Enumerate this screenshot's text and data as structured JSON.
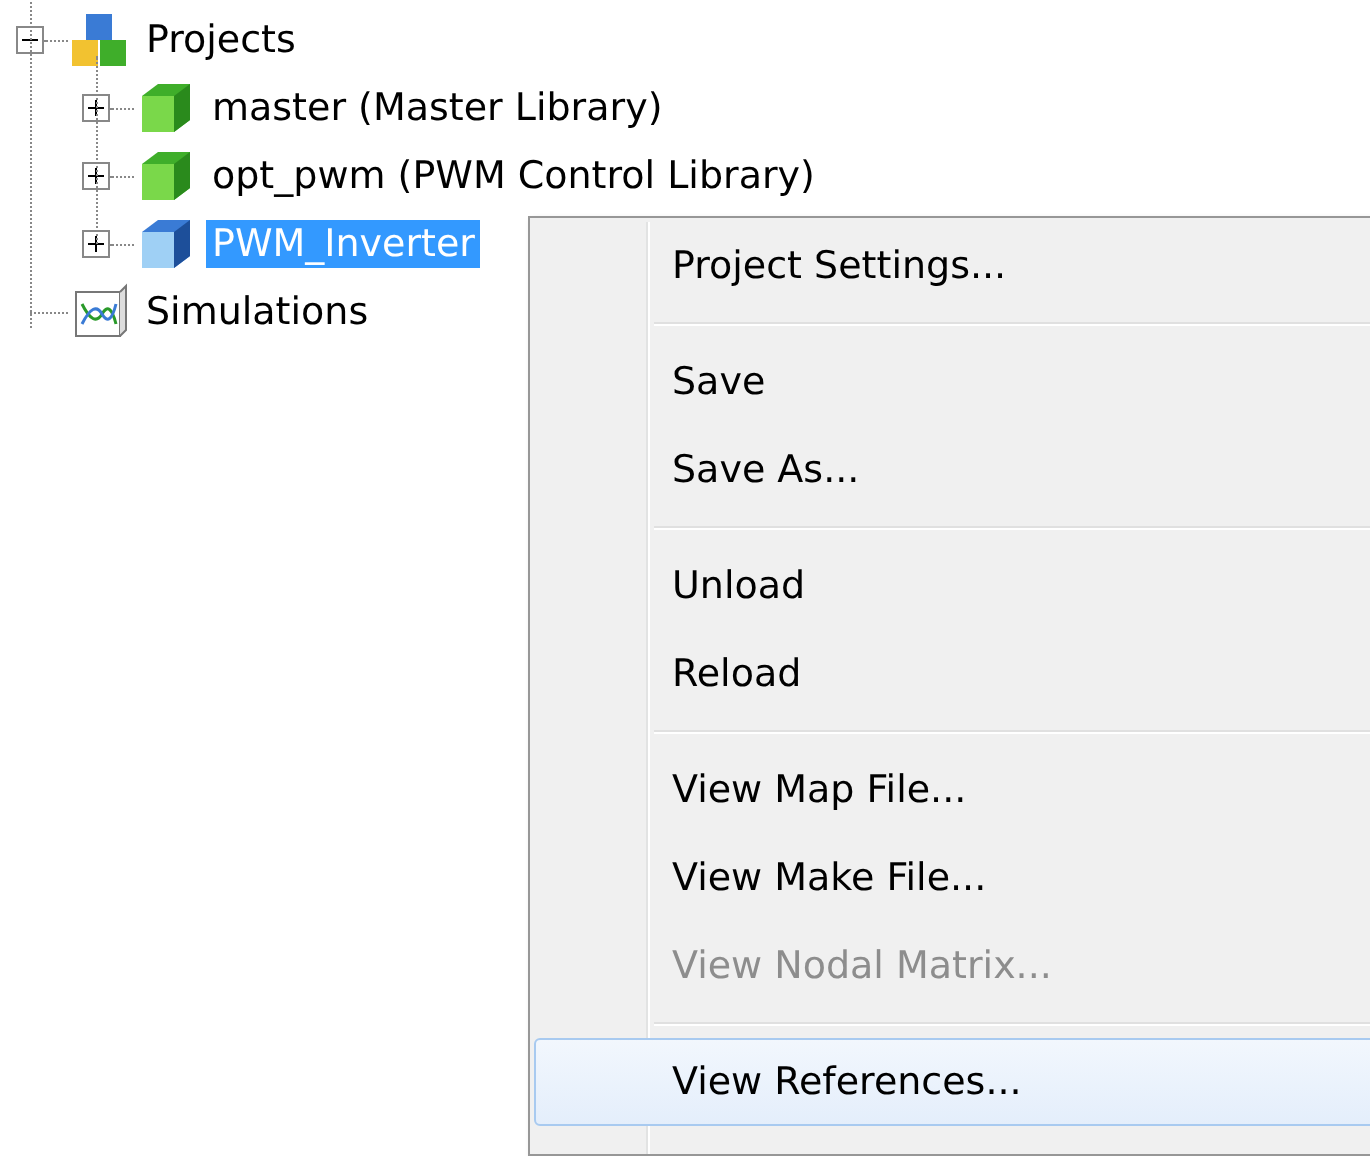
{
  "tree": {
    "label": "Projects",
    "kind": "projects",
    "expanded": true,
    "selected": false,
    "children": [
      {
        "label": "master (Master Library)",
        "kind": "library",
        "expanded": false,
        "selected": false
      },
      {
        "label": "opt_pwm (PWM Control Library)",
        "kind": "library",
        "expanded": false,
        "selected": false
      },
      {
        "label": "PWM_Inverter",
        "kind": "project",
        "expanded": false,
        "selected": true
      }
    ]
  },
  "tree_extra": {
    "label": "Simulations",
    "kind": "simulations"
  },
  "context_menu": {
    "groups": [
      [
        {
          "label": "Project Settings...",
          "disabled": false,
          "selected": false
        }
      ],
      [
        {
          "label": "Save",
          "disabled": false,
          "selected": false
        },
        {
          "label": "Save As...",
          "disabled": false,
          "selected": false
        }
      ],
      [
        {
          "label": "Unload",
          "disabled": false,
          "selected": false
        },
        {
          "label": "Reload",
          "disabled": false,
          "selected": false
        }
      ],
      [
        {
          "label": "View Map File...",
          "disabled": false,
          "selected": false
        },
        {
          "label": "View Make File...",
          "disabled": false,
          "selected": false
        },
        {
          "label": "View Nodal Matrix...",
          "disabled": true,
          "selected": false
        }
      ],
      [
        {
          "label": "View References...",
          "disabled": false,
          "selected": true
        }
      ]
    ]
  }
}
